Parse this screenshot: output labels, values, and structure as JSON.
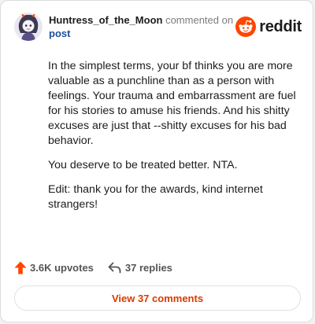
{
  "header": {
    "username": "Huntress_of_the_Moon",
    "action_text": " commented on",
    "post_link": "post"
  },
  "brand": {
    "wordmark": "reddit",
    "icon": "reddit-logo-icon",
    "color": "#ff4500"
  },
  "comment": {
    "paragraphs": [
      "In the simplest terms, your bf thinks you are more valuable as a punchline than as a person with feelings. Your trauma and embarrassment are fuel for his stories to amuse his friends. And his shitty excuses are just that --shitty excuses for his bad behavior.",
      "You deserve to be treated better. NTA.",
      "Edit: thank you for the awards, kind internet strangers!"
    ]
  },
  "actions": {
    "upvotes": "3.6K upvotes",
    "upvote_icon": "upvote-arrow-icon",
    "upvote_color": "#ff4500",
    "replies": "37 replies",
    "reply_icon": "reply-arrow-icon"
  },
  "footer": {
    "view_comments": "View 37 comments",
    "link_color": "#d93a00"
  },
  "colors": {
    "username": "#1c1c1c",
    "meta": "#7c7c7c",
    "post_link": "#1a4f9a",
    "text": "#1c1c1c"
  }
}
